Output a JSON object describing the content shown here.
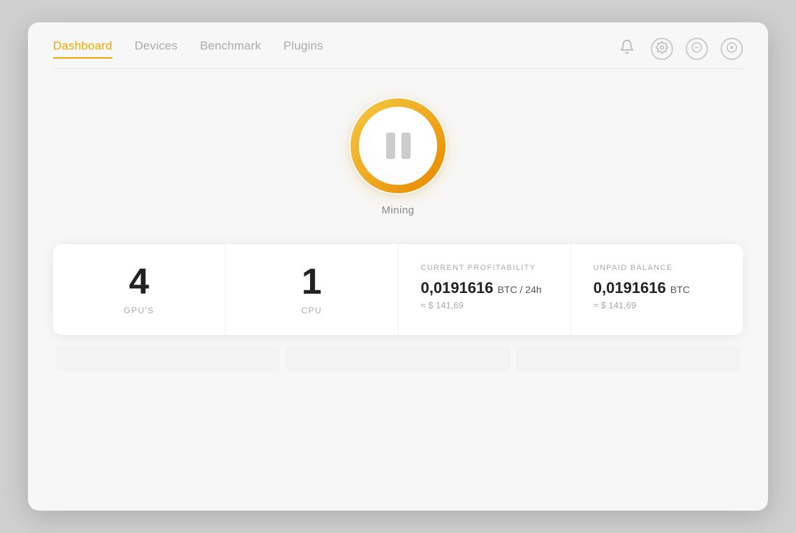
{
  "nav": {
    "items": [
      {
        "label": "Dashboard",
        "active": true
      },
      {
        "label": "Devices",
        "active": false
      },
      {
        "label": "Benchmark",
        "active": false
      },
      {
        "label": "Plugins",
        "active": false
      }
    ]
  },
  "topActions": {
    "notification_icon": "🔔",
    "settings_icon": "⚙",
    "minimize_icon": "⊖",
    "close_icon": "⊗"
  },
  "mining": {
    "status_label": "Mining",
    "button_state": "paused"
  },
  "stats": {
    "gpu_count": "4",
    "gpu_label": "GPU'S",
    "cpu_count": "1",
    "cpu_label": "CPU",
    "profitability_label": "CURRENT PROFITABILITY",
    "profitability_btc": "0,0191616",
    "profitability_unit": "BTC / 24h",
    "profitability_usd": "≈ $ 141,69",
    "balance_label": "UNPAID BALANCE",
    "balance_btc": "0,0191616",
    "balance_unit": "BTC",
    "balance_usd": "≈ $ 141,69"
  },
  "colors": {
    "accent": "#f0a500",
    "nav_active": "#f0a500",
    "text_dark": "#222222",
    "text_muted": "#aaaaaa"
  }
}
